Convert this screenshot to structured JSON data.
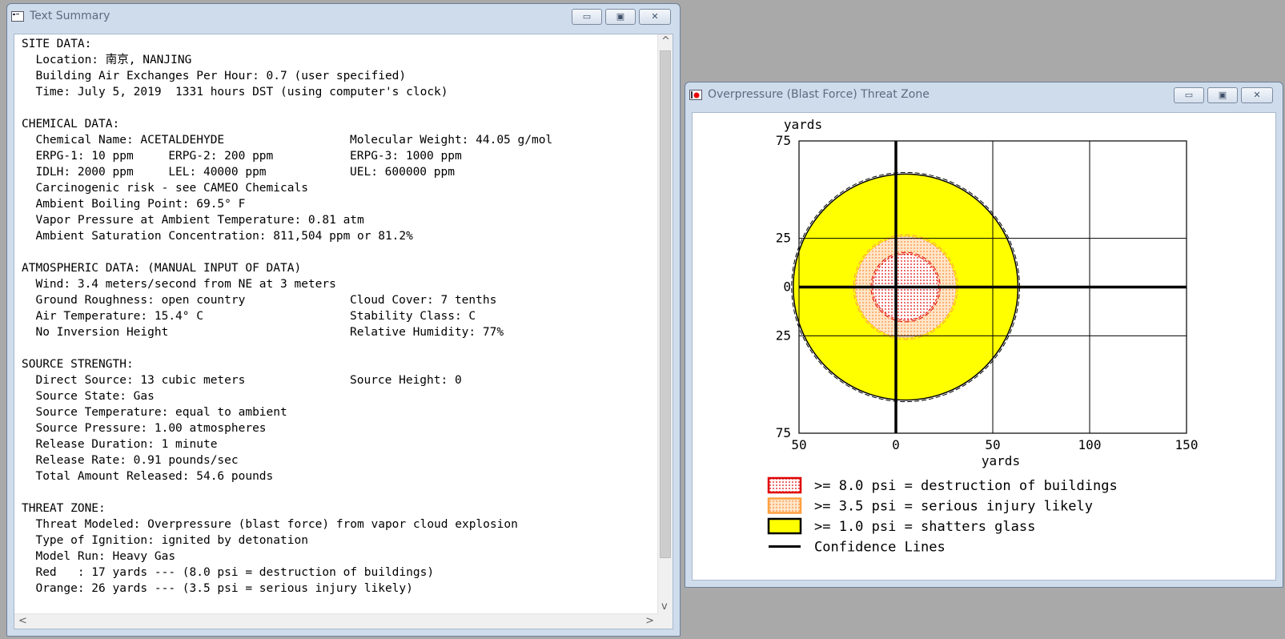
{
  "summary_window": {
    "title": "Text Summary",
    "controls": {
      "minimize": "▭",
      "maximize": "▣",
      "close": "✕"
    },
    "lines": [
      {
        "text": "SITE DATA:"
      },
      {
        "text": "  Location: 南京, NANJING"
      },
      {
        "text": "  Building Air Exchanges Per Hour: 0.7 (user specified)"
      },
      {
        "text": "  Time: July 5, 2019  1331 hours DST (using computer's clock)"
      },
      {
        "text": ""
      },
      {
        "text": "CHEMICAL DATA:"
      },
      {
        "text": "  Chemical Name: ACETALDEHYDE",
        "col2": "Molecular Weight: 44.05 g/mol"
      },
      {
        "text": "  ERPG-1: 10 ppm     ERPG-2: 200 ppm",
        "col2": "ERPG-3: 1000 ppm"
      },
      {
        "text": "  IDLH: 2000 ppm     LEL: 40000 ppm",
        "col2": "UEL: 600000 ppm"
      },
      {
        "text": "  Carcinogenic risk - see CAMEO Chemicals"
      },
      {
        "text": "  Ambient Boiling Point: 69.5° F"
      },
      {
        "text": "  Vapor Pressure at Ambient Temperature: 0.81 atm"
      },
      {
        "text": "  Ambient Saturation Concentration: 811,504 ppm or 81.2%"
      },
      {
        "text": ""
      },
      {
        "text": "ATMOSPHERIC DATA: (MANUAL INPUT OF DATA)"
      },
      {
        "text": "  Wind: 3.4 meters/second from NE at 3 meters"
      },
      {
        "text": "  Ground Roughness: open country",
        "col2": "Cloud Cover: 7 tenths"
      },
      {
        "text": "  Air Temperature: 15.4° C",
        "col2": "Stability Class: C"
      },
      {
        "text": "  No Inversion Height",
        "col2": "Relative Humidity: 77%"
      },
      {
        "text": ""
      },
      {
        "text": "SOURCE STRENGTH:"
      },
      {
        "text": "  Direct Source: 13 cubic meters",
        "col2": "Source Height: 0"
      },
      {
        "text": "  Source State: Gas"
      },
      {
        "text": "  Source Temperature: equal to ambient"
      },
      {
        "text": "  Source Pressure: 1.00 atmospheres"
      },
      {
        "text": "  Release Duration: 1 minute"
      },
      {
        "text": "  Release Rate: 0.91 pounds/sec"
      },
      {
        "text": "  Total Amount Released: 54.6 pounds"
      },
      {
        "text": ""
      },
      {
        "text": "THREAT ZONE:"
      },
      {
        "text": "  Threat Modeled: Overpressure (blast force) from vapor cloud explosion"
      },
      {
        "text": "  Type of Ignition: ignited by detonation"
      },
      {
        "text": "  Model Run: Heavy Gas"
      },
      {
        "text": "  Red   : 17 yards --- (8.0 psi = destruction of buildings)"
      },
      {
        "text": "  Orange: 26 yards --- (3.5 psi = serious injury likely)"
      }
    ],
    "scroll": {
      "up": "^",
      "down": "v",
      "left": "<",
      "right": ">"
    }
  },
  "zone_window": {
    "title": "Overpressure (Blast Force) Threat Zone",
    "controls": {
      "minimize": "▭",
      "maximize": "▣",
      "close": "✕"
    }
  },
  "chart_data": {
    "type": "scatter",
    "xlabel": "yards",
    "ylabel": "yards",
    "x_ticks": [
      "50",
      "0",
      "50",
      "100",
      "150"
    ],
    "y_ticks": [
      "75",
      "25",
      "0",
      "25",
      "75"
    ],
    "xlim": [
      -50,
      150
    ],
    "ylim": [
      -75,
      75
    ],
    "grid": true,
    "zones": [
      {
        "name": ">= 8.0 psi = destruction of buildings",
        "color": "#e00000",
        "fill": "dotted",
        "center": [
          5,
          0
        ],
        "radius": 17
      },
      {
        "name": ">= 3.5 psi = serious injury likely",
        "color": "#ffa040",
        "fill": "dotted",
        "center": [
          5,
          0
        ],
        "radius": 26
      },
      {
        "name": ">= 1.0 psi = shatters glass",
        "color": "#ffff00",
        "fill": "solid",
        "center": [
          5,
          0
        ],
        "radius": 58
      }
    ],
    "confidence_lines_label": "Confidence Lines",
    "legend": [
      {
        "label": ">= 8.0 psi = destruction of buildings",
        "swatch": "red-dotted"
      },
      {
        "label": ">= 3.5 psi = serious injury likely",
        "swatch": "orange-dotted"
      },
      {
        "label": ">= 1.0 psi = shatters glass",
        "swatch": "yellow"
      },
      {
        "label": "Confidence Lines",
        "swatch": "line"
      }
    ],
    "legend_position": "bottom"
  }
}
